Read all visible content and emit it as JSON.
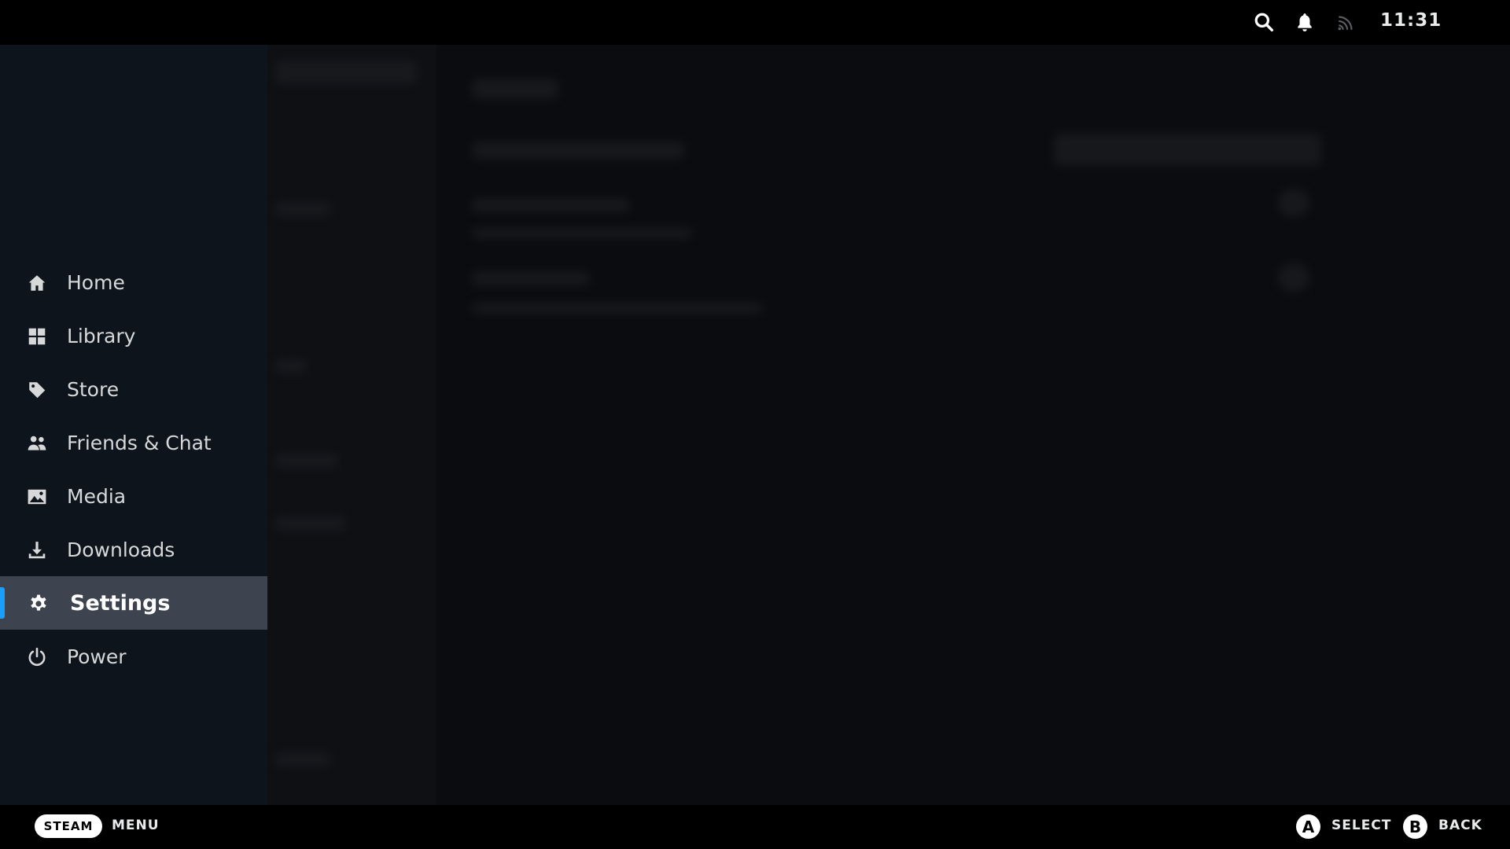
{
  "status_bar": {
    "time": "11:31",
    "icons": [
      "search-icon",
      "bell-icon",
      "cast-icon"
    ]
  },
  "menu": {
    "items": [
      {
        "label": "Home",
        "icon": "home-icon"
      },
      {
        "label": "Library",
        "icon": "grid-icon"
      },
      {
        "label": "Store",
        "icon": "tag-icon"
      },
      {
        "label": "Friends & Chat",
        "icon": "people-icon"
      },
      {
        "label": "Media",
        "icon": "image-icon"
      },
      {
        "label": "Downloads",
        "icon": "download-icon"
      },
      {
        "label": "Settings",
        "icon": "gear-icon",
        "active": true
      },
      {
        "label": "Power",
        "icon": "power-icon"
      }
    ]
  },
  "footer": {
    "steam_label": "STEAM",
    "menu_label": "MENU",
    "a_button": "A",
    "select_label": "SELECT",
    "b_button": "B",
    "back_label": "BACK"
  },
  "colors": {
    "accent": "#1a9fff",
    "menu_bg": "#0e141b",
    "active_bg": "#3d4450"
  }
}
